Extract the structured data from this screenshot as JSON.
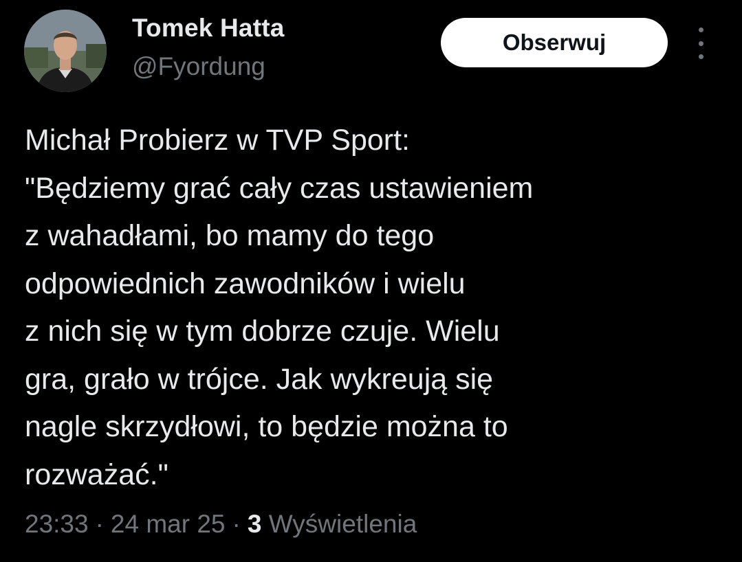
{
  "author": {
    "name": "Tomek Hatta",
    "handle": "@Fyordung"
  },
  "follow_button": {
    "label": "Obserwuj"
  },
  "more_menu": {
    "icon": "more-vertical-icon"
  },
  "tweet": {
    "lines": [
      "Michał Probierz w TVP Sport:",
      "\"Będziemy grać cały czas ustawieniem",
      "z wahadłami, bo mamy do tego",
      "odpowiednich zawodników i wielu",
      "z nich się w tym dobrze czuje. Wielu",
      "gra, grało w trójce. Jak wykreują się",
      "nagle skrzydłowi, to będzie można to",
      "rozważać.\""
    ]
  },
  "meta": {
    "time": "23:33",
    "separator": "·",
    "date": "24 mar 25",
    "views_count": "3",
    "views_label": "Wyświetlenia"
  },
  "colors": {
    "background": "#000000",
    "primary_text": "#e7e9ea",
    "secondary_text": "#71767b",
    "button_bg": "#ffffff",
    "button_text": "#0f1419"
  }
}
